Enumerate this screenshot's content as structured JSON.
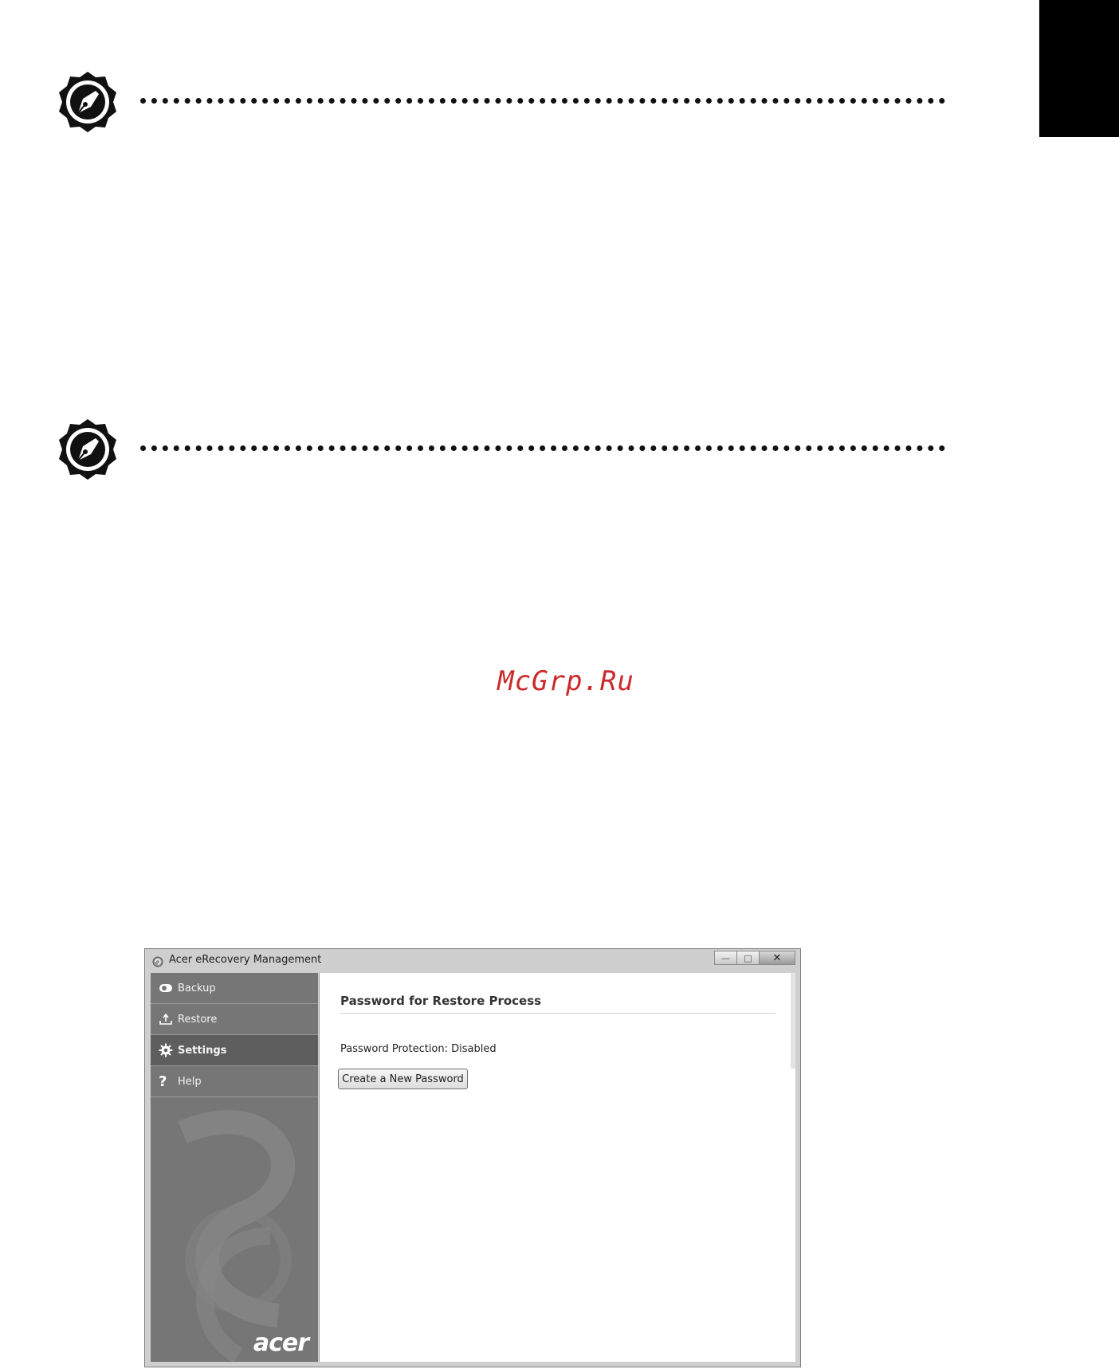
{
  "watermark": "McGrp.Ru",
  "notes": [
    {
      "icon": "note-pen-icon"
    },
    {
      "icon": "note-pen-icon"
    }
  ],
  "window": {
    "title": "Acer eRecovery Management",
    "controls": {
      "minimize": "—",
      "maximize": "□",
      "close": "✕"
    },
    "nav": [
      {
        "label": "Backup",
        "icon": "backup-icon",
        "active": false
      },
      {
        "label": "Restore",
        "icon": "restore-icon",
        "active": false
      },
      {
        "label": "Settings",
        "icon": "gear-icon",
        "active": true
      },
      {
        "label": "Help",
        "icon": "help-icon",
        "active": false
      }
    ],
    "logo": "acer",
    "content": {
      "section_title": "Password for Restore Process",
      "status": "Password Protection: Disabled",
      "button_label": "Create a New Password"
    }
  }
}
